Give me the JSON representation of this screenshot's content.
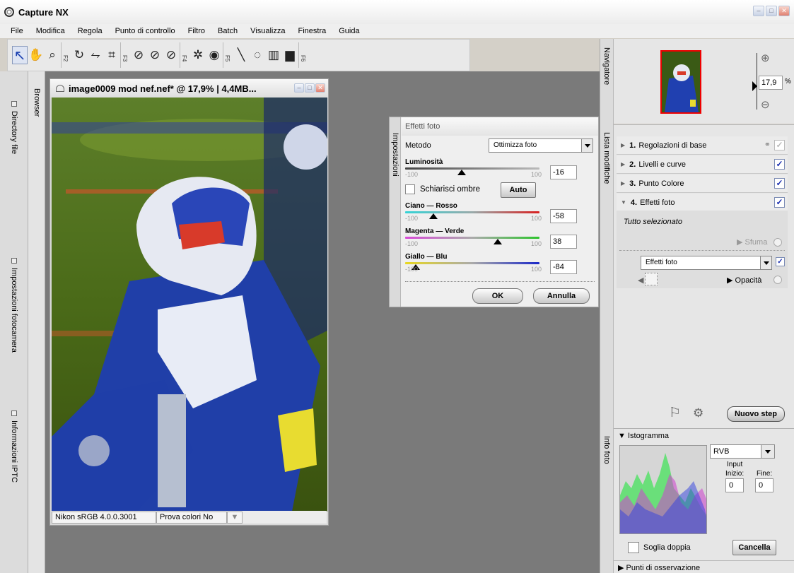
{
  "app": {
    "title": "Capture NX"
  },
  "menu": [
    "File",
    "Modifica",
    "Regola",
    "Punto di controllo",
    "Filtro",
    "Batch",
    "Visualizza",
    "Finestra",
    "Guida"
  ],
  "toolbar": {
    "fkeys": [
      "F2",
      "F3",
      "F4",
      "F5",
      "F6"
    ]
  },
  "left_dock": {
    "tabs": [
      "Directory file",
      "Impostazioni fotocamera",
      "Informazioni IPTC"
    ],
    "browser": "Browser"
  },
  "image_window": {
    "title": "image0009 mod nef.nef* @ 17,9% | 4,4MB...",
    "profile": "Nikon sRGB 4.0.0.3001",
    "proof": "Prova colori No"
  },
  "effetti": {
    "side_label": "Impostazioni",
    "header": "Effetti foto",
    "metodo_label": "Metodo",
    "metodo_value": "Ottimizza foto",
    "luminosita": {
      "label": "Luminosità",
      "min": "-100",
      "max": "100",
      "value": "-16",
      "fraction": 0.42
    },
    "schiarisci_label": "Schiarisci ombre",
    "auto_label": "Auto",
    "ciano": {
      "label": "Ciano — Rosso",
      "min": "-100",
      "max": "100",
      "value": "-58",
      "fraction": 0.21
    },
    "magenta": {
      "label": "Magenta — Verde",
      "min": "-100",
      "max": "100",
      "value": "38",
      "fraction": 0.69
    },
    "giallo": {
      "label": "Giallo — Blu",
      "min": "-100",
      "max": "100",
      "value": "-84",
      "fraction": 0.08
    },
    "ok_label": "OK",
    "annulla_label": "Annulla"
  },
  "navigator": {
    "label": "Navigatore",
    "zoom_value": "17,9",
    "zoom_unit": "%"
  },
  "edit_list": {
    "label": "Lista modifiche",
    "steps": [
      {
        "num": "1.",
        "name": "Regolazioni di base",
        "checked": false
      },
      {
        "num": "2.",
        "name": "Livelli e curve",
        "checked": true
      },
      {
        "num": "3.",
        "name": "Punto Colore",
        "checked": true
      },
      {
        "num": "4.",
        "name": "Effetti foto",
        "checked": true
      }
    ],
    "selection_text": "Tutto selezionato",
    "sfuma_label": "Sfuma",
    "effect_select": "Effetti foto",
    "opacita_label": "Opacità",
    "new_step_label": "Nuovo step"
  },
  "info": {
    "label": "Info foto",
    "histogram_label": "Istogramma",
    "channel": "RVB",
    "input_label": "Input",
    "inizio_label": "Inizio:",
    "fine_label": "Fine:",
    "inizio_value": "0",
    "fine_value": "0",
    "soglia_label": "Soglia doppia",
    "cancella_label": "Cancella",
    "punti_label": "Punti di osservazione"
  }
}
